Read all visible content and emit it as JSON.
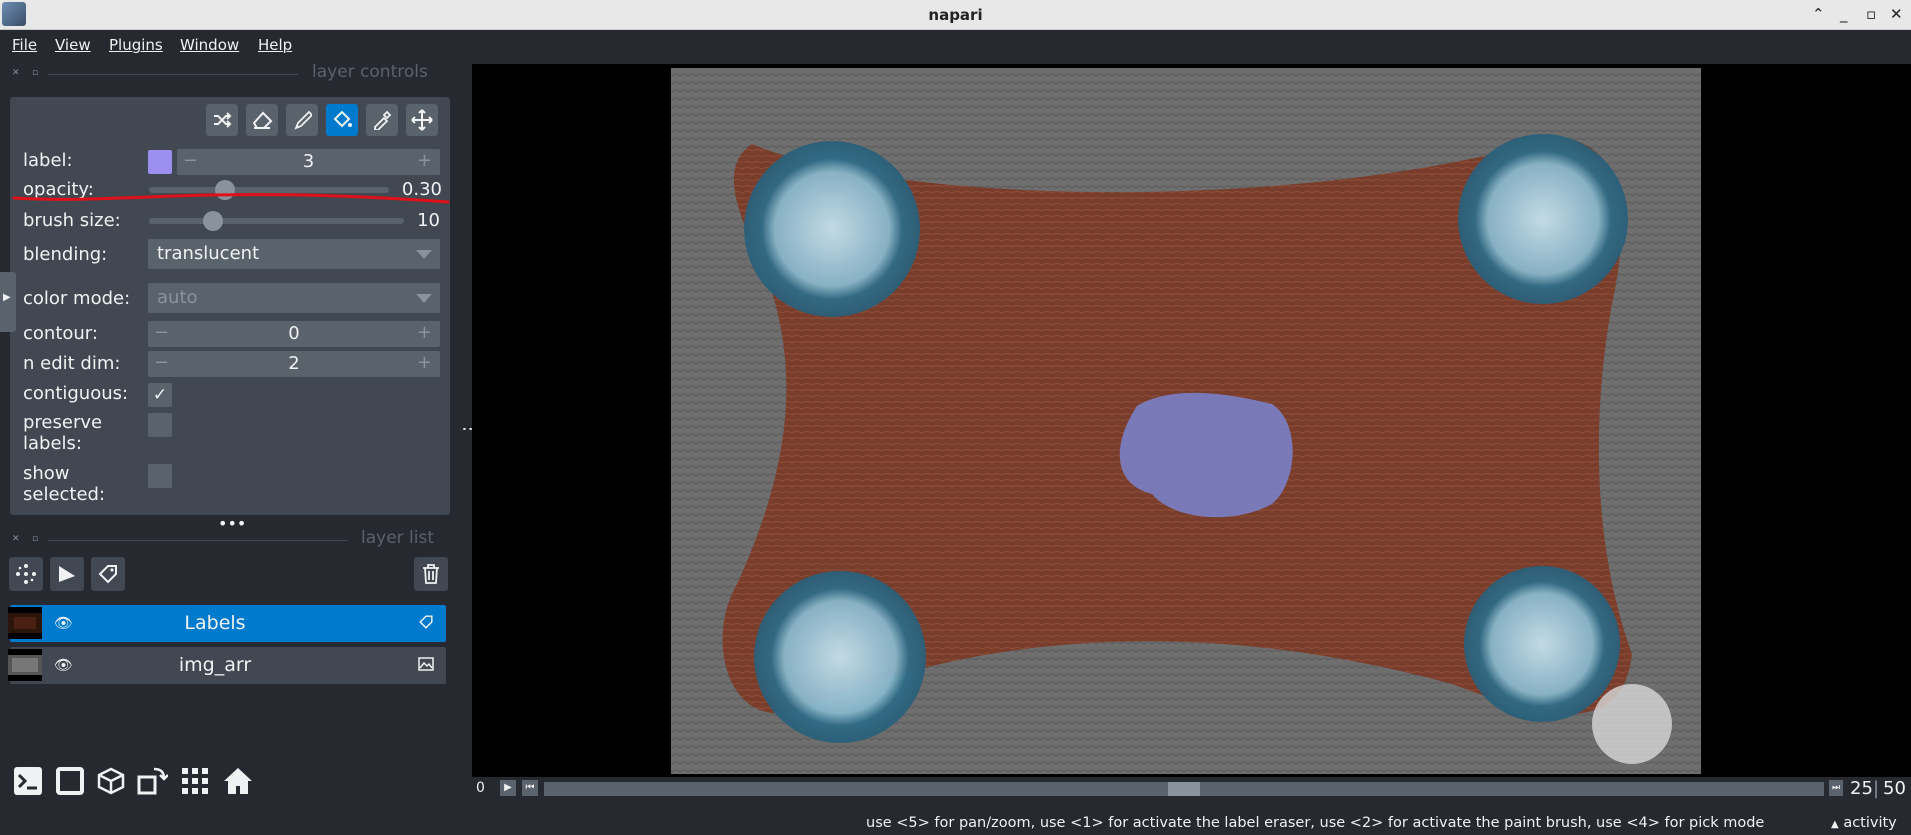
{
  "window": {
    "title": "napari"
  },
  "menu": [
    "File",
    "View",
    "Plugins",
    "Window",
    "Help"
  ],
  "docks": {
    "layer_controls_title": "layer controls",
    "layer_list_title": "layer list"
  },
  "controls": {
    "label": {
      "label": "label:",
      "value": "3",
      "swatch_color": "#9d8ff0"
    },
    "opacity": {
      "label": "opacity:",
      "value": "0.30",
      "fraction": 0.3
    },
    "brush_size": {
      "label": "brush size:",
      "value": "10"
    },
    "blending": {
      "label": "blending:",
      "value": "translucent"
    },
    "color_mode": {
      "label": "color mode:",
      "value": "auto"
    },
    "contour": {
      "label": "contour:",
      "value": "0"
    },
    "n_edit_dim": {
      "label": "n edit dim:",
      "value": "2"
    },
    "contiguous": {
      "label": "contiguous:",
      "checked": true
    },
    "preserve_labels": {
      "label_1": "preserve",
      "label_2": "labels:",
      "checked": false
    },
    "show_selected": {
      "label_1": "show",
      "label_2": "selected:",
      "checked": false
    }
  },
  "tools": [
    "shuffle-icon",
    "eraser-icon",
    "paint-brush-icon",
    "fill-bucket-icon",
    "color-picker-icon",
    "pan-zoom-icon"
  ],
  "layers": [
    {
      "name": "Labels",
      "selected": true,
      "type_icon": "label-tag-icon"
    },
    {
      "name": "img_arr",
      "selected": false,
      "type_icon": "image-icon"
    }
  ],
  "dims": {
    "start": "0",
    "current": "25",
    "total": "50",
    "position_fraction": 0.5
  },
  "status": {
    "message": "use <5> for pan/zoom, use <1> for activate the label eraser, use <2> for activate the paint brush, use <4> for pick mode",
    "activity": "activity"
  },
  "colors": {
    "accent": "#007acc",
    "background": "#262930",
    "panel": "#414851",
    "annotation_red": "#e0101a"
  }
}
